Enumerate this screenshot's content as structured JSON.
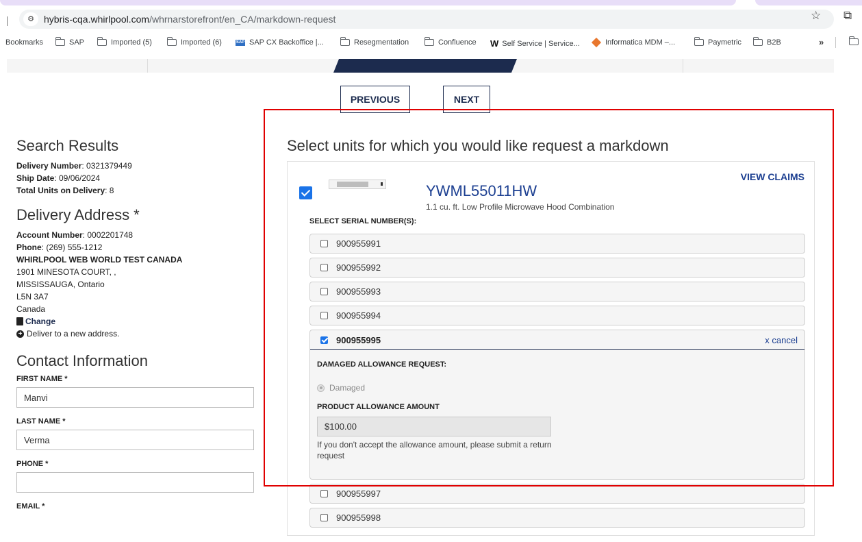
{
  "browser": {
    "url_host": "hybris-cqa.whirlpool.com",
    "url_path": "/whrnarstorefront/en_CA/markdown-request",
    "site_info_icon": "tune-icon",
    "bookmarks": [
      {
        "label": "Bookmarks",
        "icon": "none"
      },
      {
        "label": "SAP",
        "icon": "folder-icon"
      },
      {
        "label": "Imported (5)",
        "icon": "folder-icon"
      },
      {
        "label": "Imported (6)",
        "icon": "folder-icon"
      },
      {
        "label": "SAP CX Backoffice |...",
        "icon": "sap-icon"
      },
      {
        "label": "Resegmentation",
        "icon": "folder-icon"
      },
      {
        "label": "Confluence",
        "icon": "folder-icon"
      },
      {
        "label": "Self Service | Service...",
        "icon": "w-icon"
      },
      {
        "label": "Informatica MDM –...",
        "icon": "informatica-icon"
      },
      {
        "label": "Paymetric",
        "icon": "folder-icon"
      },
      {
        "label": "B2B",
        "icon": "folder-icon"
      }
    ],
    "more_label": "»"
  },
  "nav": {
    "previous": "PREVIOUS",
    "next": "NEXT"
  },
  "search_results": {
    "title": "Search Results",
    "delivery_number_label": "Delivery Number",
    "delivery_number": ": 0321379449",
    "ship_date_label": "Ship Date",
    "ship_date": ": 09/06/2024",
    "total_units_label": "Total Units on Delivery",
    "total_units": ": 8"
  },
  "delivery_address": {
    "title": "Delivery Address *",
    "account_label": "Account Number",
    "account": ": 0002201748",
    "phone_label": "Phone",
    "phone": ": (269) 555-1212",
    "company": "WHIRLPOOL WEB WORLD TEST CANADA",
    "street": "1901 MINESOTA COURT, ,",
    "city": "MISSISSAUGA,  Ontario",
    "postal": "L5N 3A7",
    "country": "Canada",
    "change_link": "Change",
    "new_address_link": "Deliver to a new address."
  },
  "contact": {
    "title": "Contact Information",
    "first_name_label": "FIRST NAME *",
    "first_name": "Manvi",
    "last_name_label": "LAST NAME *",
    "last_name": "Verma",
    "phone_label": "PHONE *",
    "phone": "",
    "email_label": "EMAIL *"
  },
  "markdown": {
    "heading": "Select units for which you would like request a markdown",
    "model": "YWML55011HW",
    "description": "1.1 cu. ft. Low Profile Microwave Hood Combination",
    "view_claims": "VIEW CLAIMS",
    "select_serial_label": "SELECT SERIAL NUMBER(S):",
    "serials_top": [
      "900955991",
      "900955992",
      "900955993",
      "900955994"
    ],
    "selected_serial": "900955995",
    "cancel": "x  cancel",
    "damaged_allowance_label": "DAMAGED ALLOWANCE REQUEST:",
    "damaged_option": "Damaged",
    "allowance_amount_label": "PRODUCT ALLOWANCE AMOUNT",
    "allowance_amount": "$100.00",
    "allowance_note": "If you don't accept the allowance amount, please submit a return request",
    "serials_bottom": [
      "900955997",
      "900955998"
    ]
  },
  "colors": {
    "brand_navy": "#1c2b4e",
    "link_blue": "#1c3f91",
    "checkbox_blue": "#1a73e8",
    "highlight_red": "#e00000"
  }
}
